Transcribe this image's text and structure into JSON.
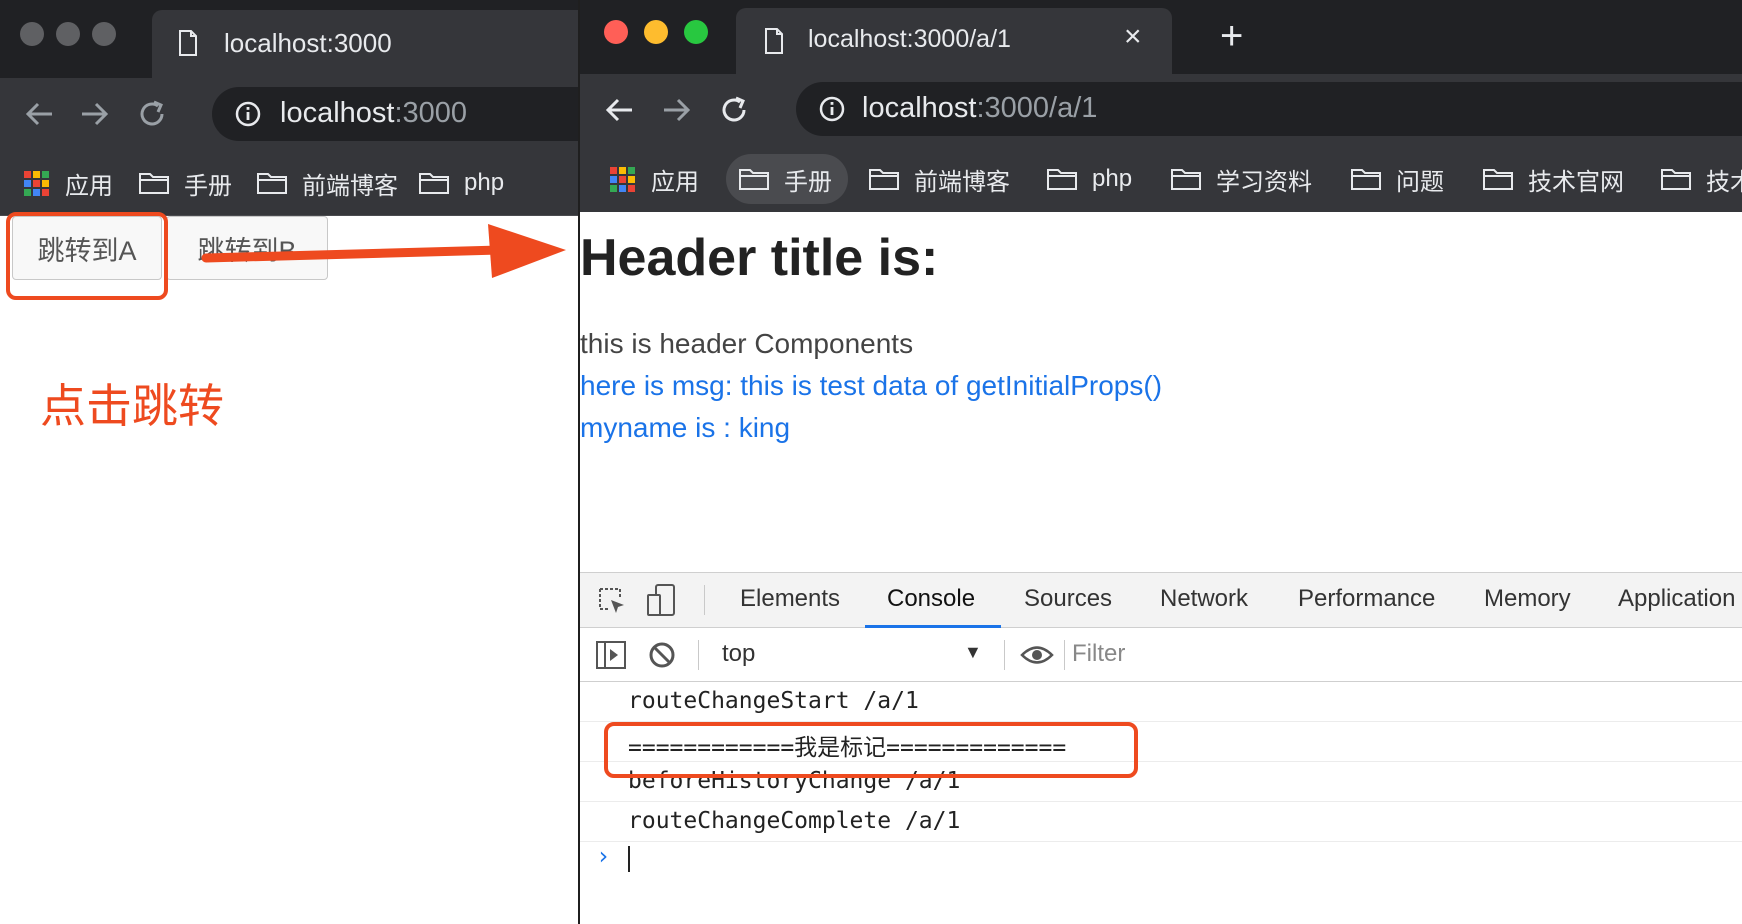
{
  "left_window": {
    "tab_title": "localhost:3000",
    "url_host": "localhost",
    "url_rest": ":3000",
    "bookmarks": [
      "应用",
      "手册",
      "前端博客",
      "php"
    ],
    "buttons": {
      "jump_a": "跳转到A",
      "jump_b": "跳转到B"
    },
    "annotation": "点击跳转"
  },
  "right_window": {
    "tab_title": "localhost:3000/a/1",
    "tab_close": "×",
    "new_tab": "+",
    "url_host": "localhost",
    "url_rest": ":3000/a/1",
    "bookmarks": [
      "应用",
      "手册",
      "前端博客",
      "php",
      "学习资料",
      "问题",
      "技术官网",
      "技术"
    ],
    "page": {
      "header_title": "Header title is:",
      "line1": "this is header Components",
      "line2": "here is msg: this is test data of getInitialProps()",
      "line3": "myname is : king"
    },
    "devtools": {
      "tabs": [
        "Elements",
        "Console",
        "Sources",
        "Network",
        "Performance",
        "Memory",
        "Application"
      ],
      "active_tab": "Console",
      "context": "top",
      "filter_placeholder": "Filter",
      "logs": [
        "routeChangeStart /a/1",
        "============我是标记=============",
        "beforeHistoryChange /a/1",
        "routeChangeComplete /a/1"
      ]
    }
  },
  "colors": {
    "annotation": "#ee4a1f",
    "link_blue": "#1a73e8",
    "chrome_dark": "#202124",
    "chrome_toolbar": "#35363a"
  }
}
